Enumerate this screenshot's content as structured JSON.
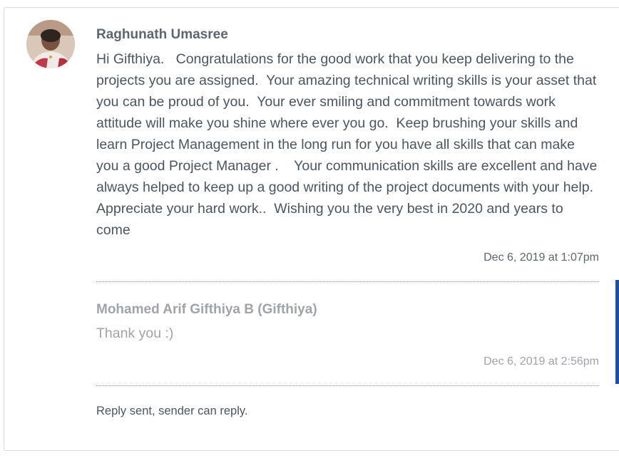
{
  "message": {
    "sender": "Raghunath Umasree",
    "body": "Hi Gifthiya.   Congratulations for the good work that you keep delivering to the projects you are assigned.  Your amazing technical writing skills is your asset that you can be proud of you.  Your ever smiling and commitment towards work attitude will make you shine where ever you go.  Keep brushing your skills and learn Project Management in the long run for you have all skills that can make you a good Project Manager .    Your communication skills are excellent and have always helped to keep up a good writing of the project documents with your help.   Appreciate your hard work..  Wishing you the very best in 2020 and years to come",
    "timestamp": "Dec 6, 2019 at 1:07pm",
    "avatar_icon": "user-photo"
  },
  "reply": {
    "sender": "Mohamed Arif Gifthiya B (Gifthiya)",
    "body": "Thank you :)",
    "timestamp": "Dec 6, 2019 at 2:56pm"
  },
  "footer": {
    "status": "Reply sent, sender can reply."
  },
  "colors": {
    "accent": "#1e4fa8",
    "text": "#4a5560",
    "muted": "#a0a3a7"
  }
}
